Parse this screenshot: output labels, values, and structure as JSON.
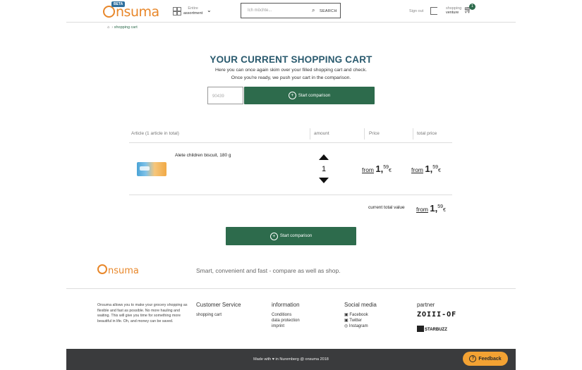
{
  "header": {
    "logo_text": "nsuma",
    "beta": "BETA",
    "assortment_top": "Entire",
    "assortment_bottom": "assortment",
    "search_placeholder": "Ich möchte...",
    "search_label": "SEARCH",
    "signout": "Sign out",
    "cart_top": "shopping",
    "cart_bottom": "venture",
    "cart_count": "1"
  },
  "breadcrumb": {
    "current": "shopping cart"
  },
  "intro": {
    "title": "YOUR CURRENT SHOPPING CART",
    "line1": "Here you can once again skim over your filled shopping cart and check.",
    "line2": "Once you're ready, we push your cart in the comparison."
  },
  "zip_value": "90439",
  "compare_label": "Start comparison",
  "table": {
    "headers": {
      "article": "Article (1 article in total)",
      "amount": "amount",
      "price": "Price",
      "total": "total price"
    },
    "rows": [
      {
        "name": "Alete children biscuit, 180 g",
        "quantity": "1",
        "price_from": "from",
        "price_main": "1,",
        "price_cents": "59",
        "price_currency": "€",
        "total_from": "from",
        "total_main": "1,",
        "total_cents": "59",
        "total_currency": "€"
      }
    ],
    "summary": {
      "label": "current total value",
      "from": "from",
      "main": "1,",
      "cents": "59",
      "currency": "€"
    }
  },
  "footer": {
    "logo_text": "nsuma",
    "tagline": "Smart, convenient and fast - compare as well as shop.",
    "about": "Onsuma allows you to make your grocery shopping as flexible and fast as possible. No more hauling and waiting. This will give you time for something more beautiful in life. Oh, and money can be saved.",
    "customer_service": {
      "heading": "Customer Service",
      "links": [
        "shopping cart"
      ]
    },
    "information": {
      "heading": "information",
      "links": [
        "Conditions",
        "data protection",
        "imprint"
      ]
    },
    "social": {
      "heading": "Social media",
      "links": [
        "Facebook",
        "Twitter",
        "Instagram"
      ]
    },
    "partner": {
      "heading": "partner",
      "partner1": "ZOIII-OF",
      "partner2": "STARBUZZ"
    },
    "made_with": "Made with ♥ in Nuremberg @ onsuma 2018",
    "feedback": "Feedback"
  },
  "colors": {
    "brand_green": "#2d6b4c",
    "brand_orange": "#e8872a",
    "title_blue": "#2a5a6e"
  }
}
